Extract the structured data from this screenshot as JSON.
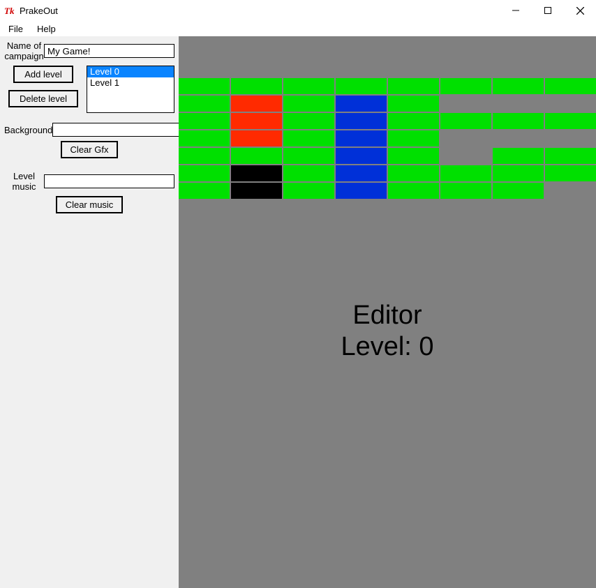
{
  "window": {
    "title": "PrakeOut"
  },
  "menubar": {
    "file": "File",
    "help": "Help"
  },
  "sidebar": {
    "campaign_label": "Name of campaign",
    "campaign_value": "My Game!",
    "add_level": "Add level",
    "delete_level": "Delete level",
    "background_label": "Background",
    "background_value": "",
    "clear_gfx": "Clear Gfx",
    "music_label": "Level music",
    "music_value": "",
    "clear_music": "Clear music",
    "levels": [
      {
        "label": "Level 0",
        "selected": true
      },
      {
        "label": "Level 1",
        "selected": false
      }
    ]
  },
  "editor": {
    "line1": "Editor",
    "line2": "Level: 0",
    "current_level": 0,
    "grid_cols": 8,
    "grid_rows": 7,
    "palette": {
      "green": "#00e000",
      "red": "#ff2a00",
      "blue": "#0030d8",
      "black": "#000000",
      "gray": "#808080"
    },
    "grid": [
      [
        "green",
        "green",
        "green",
        "green",
        "green",
        "green",
        "green",
        "green"
      ],
      [
        "green",
        "red",
        "green",
        "blue",
        "green",
        "gray",
        "gray",
        "gray"
      ],
      [
        "green",
        "red",
        "green",
        "blue",
        "green",
        "green",
        "green",
        "green"
      ],
      [
        "green",
        "red",
        "green",
        "blue",
        "green",
        "gray",
        "gray",
        "gray"
      ],
      [
        "green",
        "green",
        "green",
        "blue",
        "green",
        "gray",
        "green",
        "green"
      ],
      [
        "green",
        "black",
        "green",
        "blue",
        "green",
        "green",
        "green",
        "green"
      ],
      [
        "green",
        "black",
        "green",
        "blue",
        "green",
        "green",
        "green",
        "gray"
      ]
    ]
  }
}
